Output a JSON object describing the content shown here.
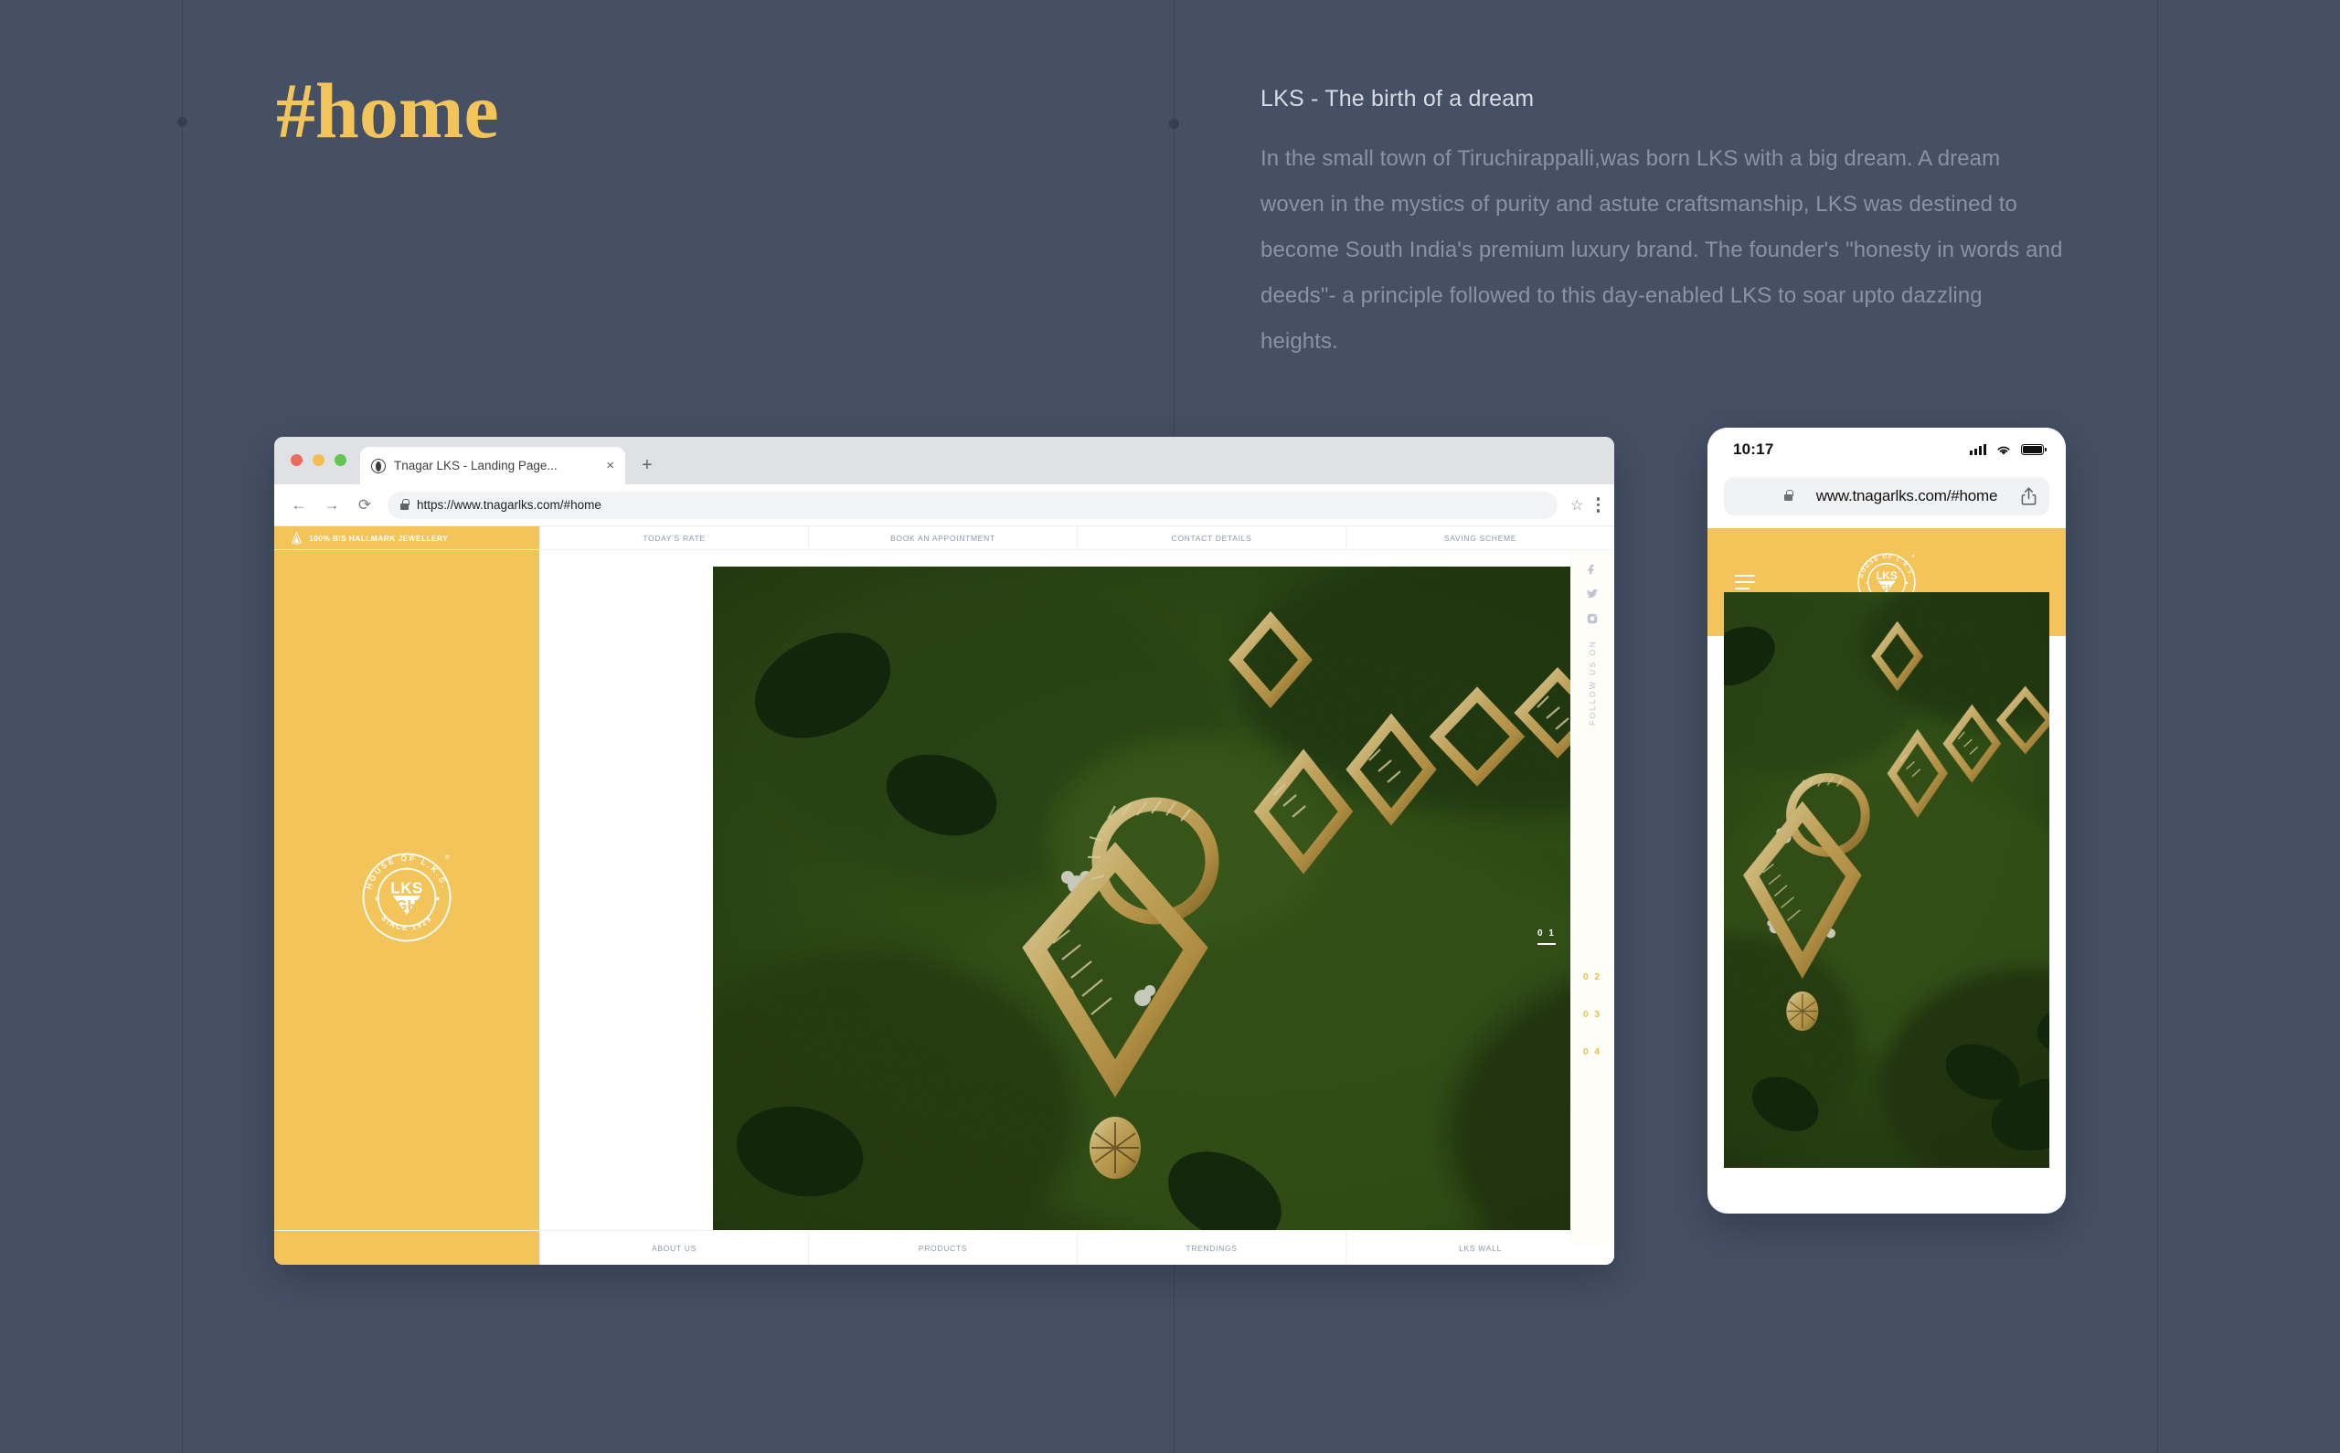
{
  "theme": {
    "background": "#455065",
    "accent_gold": "#f2c45a",
    "heading_gold": "#f2c45a",
    "body_text": "#8a93a6",
    "title_text": "#d7dbe3"
  },
  "heading": {
    "text": "#home"
  },
  "copy": {
    "title": "LKS - The birth of a dream",
    "body": "In the small town of Tiruchirappalli,was born LKS with a big dream. A dream woven in the mystics of purity and astute craftsmanship, LKS was destined to become South India's premium luxury brand. The founder's \"honesty in words and deeds\"- a principle followed to this day-enabled LKS to soar upto dazzling heights."
  },
  "browser": {
    "traffic_lights": [
      "close",
      "minimize",
      "maximize"
    ],
    "tab": {
      "favicon": "site-favicon",
      "title": "Tnagar LKS - Landing Page...",
      "close_label": "×"
    },
    "new_tab_label": "+",
    "toolbar": {
      "back_label": "←",
      "forward_label": "→",
      "reload_label": "⟳",
      "url": "https://www.tnagarlks.com/#home",
      "bookmark_label": "☆",
      "menu_label": "kebab-menu"
    }
  },
  "site": {
    "brand_badge": "100% BIS HALLMARK JEWELLERY",
    "top_nav": [
      {
        "label": "TODAY'S RATE"
      },
      {
        "label": "BOOK AN APPOINTMENT"
      },
      {
        "label": "CONTACT DETAILS"
      },
      {
        "label": "SAVING SCHEME"
      }
    ],
    "bottom_nav": [
      {
        "label": "ABOUT US"
      },
      {
        "label": "PRODUCTS"
      },
      {
        "label": "TRENDINGS"
      },
      {
        "label": "LKS WALL"
      }
    ],
    "logo": {
      "top_arc": "HOUSE OF L.K.S.",
      "center_top": "LKS",
      "center_bottom": "GH",
      "bottom_arc": "SINCE 1925",
      "registered": "®"
    },
    "social": {
      "follow_label": "FOLLOW US ON",
      "icons": [
        "facebook-icon",
        "twitter-icon",
        "instagram-icon"
      ]
    },
    "slides": [
      {
        "label": "0 1",
        "active": true
      },
      {
        "label": "0 2",
        "active": false
      },
      {
        "label": "0 3",
        "active": false
      },
      {
        "label": "0 4",
        "active": false
      }
    ],
    "hero_alt": "Gold necklace on green moss"
  },
  "phone": {
    "status": {
      "time": "10:17",
      "signal": "cellular-bars-icon",
      "wifi": "wifi-icon",
      "battery": "battery-icon"
    },
    "omnibox": {
      "url": "www.tnagarlks.com/#home",
      "share_label": "share-icon"
    },
    "menu_label": "hamburger-menu",
    "hero_alt": "Gold necklace on green moss"
  }
}
